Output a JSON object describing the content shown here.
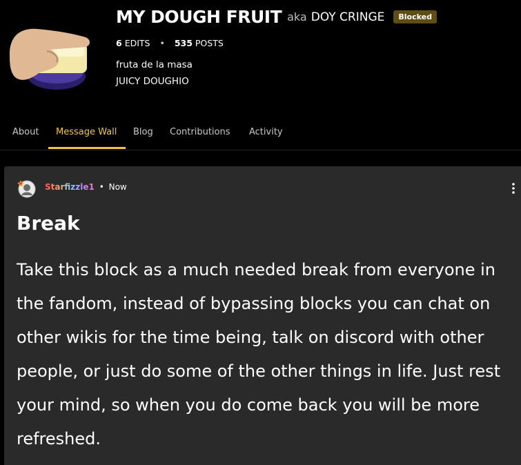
{
  "profile": {
    "name": "MY DOUGH FRUIT",
    "aka_label": "aka",
    "nickname": "DOY CRINGE",
    "status_badge": "Blocked",
    "edits_count": "6",
    "edits_label": "EDITS",
    "stats_separator": "•",
    "posts_count": "535",
    "posts_label": "POSTS",
    "bio_line_1": "fruta de la masa",
    "bio_line_2": "JUICY DOUGHIO"
  },
  "tabs": [
    {
      "label": "About"
    },
    {
      "label": "Message Wall"
    },
    {
      "label": "Blog"
    },
    {
      "label": "Contributions"
    },
    {
      "label": "Activity"
    }
  ],
  "active_tab": "Message Wall",
  "post": {
    "author": "Starfizzle1",
    "separator": "•",
    "time": "Now",
    "title": "Break",
    "body": "Take this block as a much needed break from everyone in the fandom, instead of bypassing blocks you can chat on other wikis for the time being, talk on discord with other people, or just do some of the other things in life. Just rest your mind, so when you do come back you will be more refreshed."
  },
  "icons": {
    "profile_avatar": "hand-holding-butter-avatar",
    "post_avatar": "user-avatar",
    "more": "kebab-menu-icon"
  },
  "colors": {
    "background": "#000000",
    "card": "#2a2a2a",
    "accent": "#f2c744",
    "badge": "#5f4d16"
  }
}
